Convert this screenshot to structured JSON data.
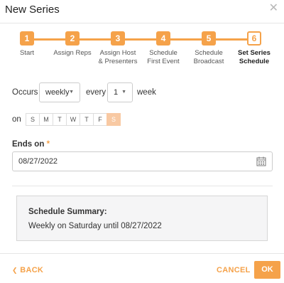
{
  "header": {
    "title": "New Series",
    "close_glyph": "✕"
  },
  "stepper": {
    "steps": [
      {
        "number": "1",
        "label": "Start",
        "state": "completed"
      },
      {
        "number": "2",
        "label": "Assign Reps",
        "state": "completed"
      },
      {
        "number": "3",
        "label": "Assign Host\n& Presenters",
        "state": "completed"
      },
      {
        "number": "4",
        "label": "Schedule\nFirst Event",
        "state": "completed"
      },
      {
        "number": "5",
        "label": "Schedule\nBroadcast",
        "state": "completed"
      },
      {
        "number": "6",
        "label": "Set Series\nSchedule",
        "state": "active"
      }
    ]
  },
  "schedule": {
    "occurs_label": "Occurs",
    "frequency_value": "weekly",
    "every_label": "every",
    "interval_value": "1",
    "unit_label": "week",
    "on_label": "on",
    "days": [
      {
        "label": "S",
        "selected": false
      },
      {
        "label": "M",
        "selected": false
      },
      {
        "label": "T",
        "selected": false
      },
      {
        "label": "W",
        "selected": false
      },
      {
        "label": "T",
        "selected": false
      },
      {
        "label": "F",
        "selected": false
      },
      {
        "label": "S",
        "selected": true
      }
    ],
    "ends_on_label": "Ends on",
    "required_marker": "*",
    "ends_on_value": "08/27/2022"
  },
  "summary": {
    "title": "Schedule Summary:",
    "text": "Weekly on Saturday until 08/27/2022"
  },
  "footer": {
    "back_label": "BACK",
    "back_glyph": "❮",
    "cancel_label": "CANCEL",
    "ok_label": "OK"
  },
  "colors": {
    "accent": "#f5a24a",
    "selected_day": "#f8c9a3",
    "summary_bg": "#f5f5f6"
  },
  "icons": [
    "close-icon",
    "caret-down-icon",
    "calendar-icon",
    "chevron-left-icon"
  ]
}
